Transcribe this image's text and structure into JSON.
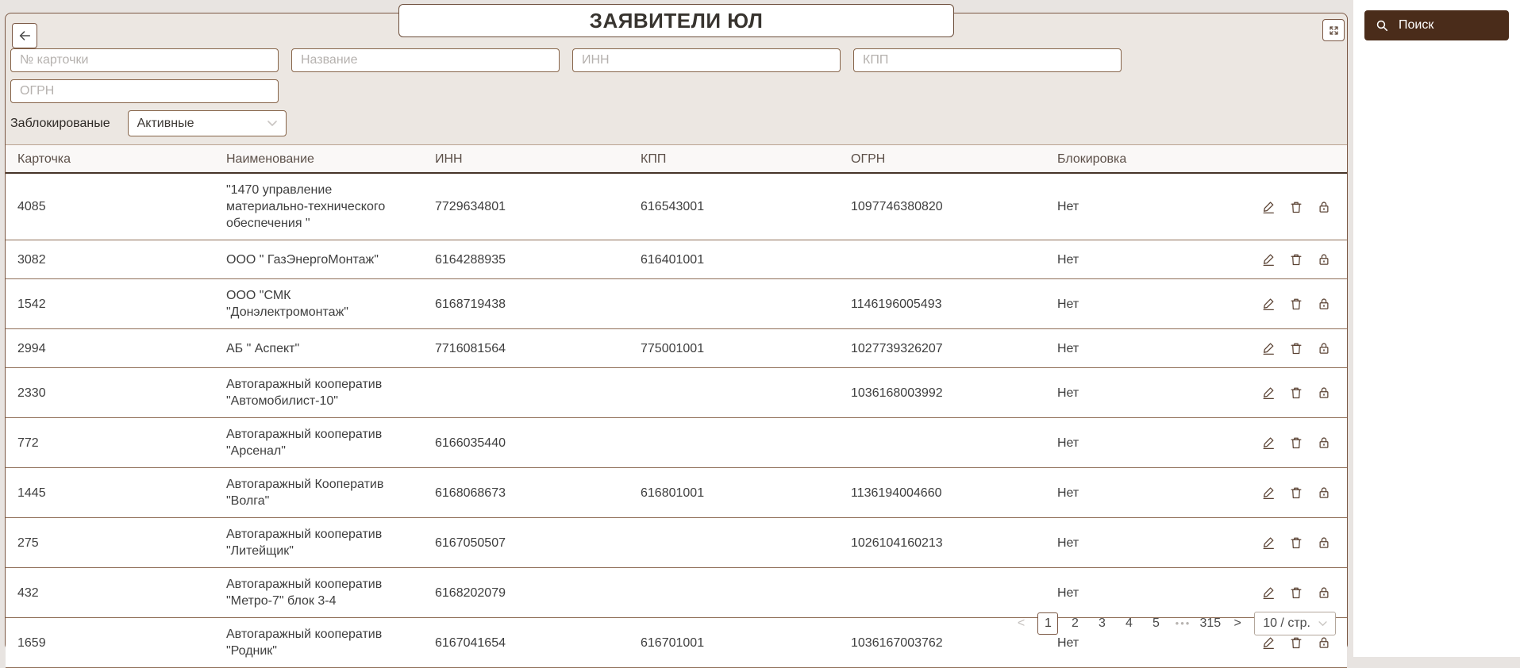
{
  "page": {
    "title": "ЗАЯВИТЕЛИ ЮЛ"
  },
  "search_panel": {
    "label": "Поиск"
  },
  "filters": {
    "card_number_placeholder": "№ карточки",
    "name_placeholder": "Название",
    "inn_placeholder": "ИНН",
    "kpp_placeholder": "КПП",
    "ogrn_placeholder": "ОГРН",
    "blocked_label": "Заблокированые",
    "blocked_value": "Активные"
  },
  "table": {
    "columns": [
      "Карточка",
      "Наименование",
      "ИНН",
      "КПП",
      "ОГРН",
      "Блокировка"
    ],
    "rows": [
      {
        "card": "4085",
        "name": "\"1470 управление материально-технического обеспечения \"",
        "inn": "7729634801",
        "kpp": "616543001",
        "ogrn": "1097746380820",
        "blocked": "Нет"
      },
      {
        "card": "3082",
        "name": "ООО \" ГазЭнергоМонтаж\"",
        "inn": "6164288935",
        "kpp": "616401001",
        "ogrn": "",
        "blocked": "Нет"
      },
      {
        "card": "1542",
        "name": "ООО \"СМК \"Донэлектромонтаж\"",
        "inn": "6168719438",
        "kpp": "",
        "ogrn": "1146196005493",
        "blocked": "Нет"
      },
      {
        "card": "2994",
        "name": "АБ \" Аспект\"",
        "inn": "7716081564",
        "kpp": "775001001",
        "ogrn": "1027739326207",
        "blocked": "Нет"
      },
      {
        "card": "2330",
        "name": "Автогаражный кооператив \"Автомобилист-10\"",
        "inn": "",
        "kpp": "",
        "ogrn": "1036168003992",
        "blocked": "Нет"
      },
      {
        "card": "772",
        "name": "Автогаражный кооператив \"Арсенал\"",
        "inn": "6166035440",
        "kpp": "",
        "ogrn": "",
        "blocked": "Нет"
      },
      {
        "card": "1445",
        "name": "Автогаражный Кооператив \"Волга\"",
        "inn": "6168068673",
        "kpp": "616801001",
        "ogrn": "1136194004660",
        "blocked": "Нет"
      },
      {
        "card": "275",
        "name": "Автогаражный кооператив \"Литейщик\"",
        "inn": "6167050507",
        "kpp": "",
        "ogrn": "1026104160213",
        "blocked": "Нет"
      },
      {
        "card": "432",
        "name": "Автогаражный кооператив \"Метро-7\" блок 3-4",
        "inn": "6168202079",
        "kpp": "",
        "ogrn": "",
        "blocked": "Нет"
      },
      {
        "card": "1659",
        "name": "Автогаражный кооператив \"Родник\"",
        "inn": "6167041654",
        "kpp": "616701001",
        "ogrn": "1036167003762",
        "blocked": "Нет"
      }
    ]
  },
  "pagination": {
    "prev": "<",
    "next": ">",
    "pages": [
      "1",
      "2",
      "3",
      "4",
      "5"
    ],
    "active_page": "1",
    "ellipsis": "•••",
    "last_page": "315",
    "page_size": "10 / стр."
  },
  "icons": {
    "back": "arrow-left",
    "expand": "fullscreen",
    "search": "magnifier",
    "edit": "pencil",
    "delete": "trash",
    "lock": "padlock",
    "select_chevron": "chevron-down"
  },
  "colors": {
    "accent_border": "#7a5743",
    "search_bar_bg": "#4a2c1a",
    "panel_bg": "#ece7e2",
    "row_border": "#8f6e57",
    "text": "#3e3e3e"
  }
}
